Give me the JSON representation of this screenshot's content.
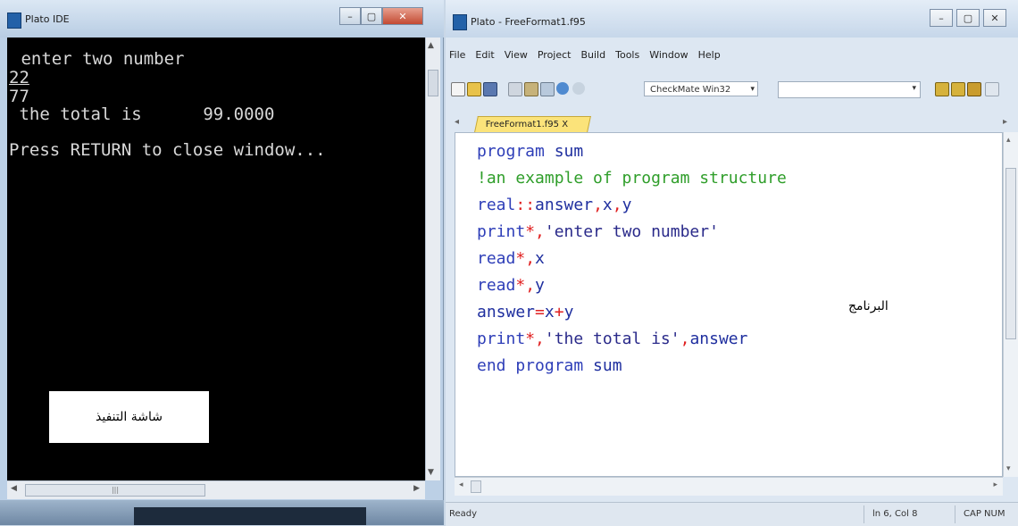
{
  "console": {
    "title": "Plato IDE",
    "lines": [
      " enter two number",
      "22",
      "77",
      " the total is      99.0000",
      "Press RETURN to close window..."
    ],
    "overlay_label": "شاشة التنفيذ"
  },
  "ide": {
    "title": "Plato - FreeFormat1.f95",
    "menu": [
      "File",
      "Edit",
      "View",
      "Project",
      "Build",
      "Tools",
      "Window",
      "Help"
    ],
    "toolbar": {
      "config_value": "CheckMate Win32"
    },
    "tab": {
      "label": "FreeFormat1.f95 X"
    },
    "code": [
      {
        "parts": [
          [
            "kw",
            "program"
          ],
          [
            "id",
            " sum"
          ]
        ]
      },
      {
        "parts": [
          [
            "cm",
            "!an example of program structure"
          ]
        ]
      },
      {
        "parts": [
          [
            "kw",
            "real"
          ],
          [
            "op",
            "::"
          ],
          [
            "id",
            "answer"
          ],
          [
            "op",
            ","
          ],
          [
            "id",
            "x"
          ],
          [
            "op",
            ","
          ],
          [
            "id",
            "y"
          ]
        ]
      },
      {
        "parts": [
          [
            "kw",
            "print"
          ],
          [
            "op",
            "*,"
          ],
          [
            "st",
            "'enter two number'"
          ]
        ]
      },
      {
        "parts": [
          [
            "kw",
            "read"
          ],
          [
            "op",
            "*,"
          ],
          [
            "id",
            "x"
          ]
        ]
      },
      {
        "parts": [
          [
            "kw",
            "read"
          ],
          [
            "op",
            "*,"
          ],
          [
            "id",
            "y"
          ]
        ]
      },
      {
        "parts": [
          [
            "id",
            "answer"
          ],
          [
            "op",
            "="
          ],
          [
            "id",
            "x"
          ],
          [
            "op",
            "+"
          ],
          [
            "id",
            "y"
          ]
        ]
      },
      {
        "parts": [
          [
            "kw",
            "print"
          ],
          [
            "op",
            "*,"
          ],
          [
            "st",
            "'the total is'"
          ],
          [
            "op",
            ","
          ],
          [
            "id",
            "answer"
          ]
        ]
      },
      {
        "parts": [
          [
            "kw",
            "end program"
          ],
          [
            "id",
            " sum"
          ]
        ]
      }
    ],
    "editor_annotation": "البرنامج",
    "status": {
      "left": "Ready",
      "position": "ln 6, Col 8",
      "caps": "CAP NUM"
    }
  },
  "colors": {
    "keyword": "#2e3eb8",
    "comment": "#2f9e2a",
    "operator": "#e02020",
    "tab_yellow": "#fbe37a"
  }
}
